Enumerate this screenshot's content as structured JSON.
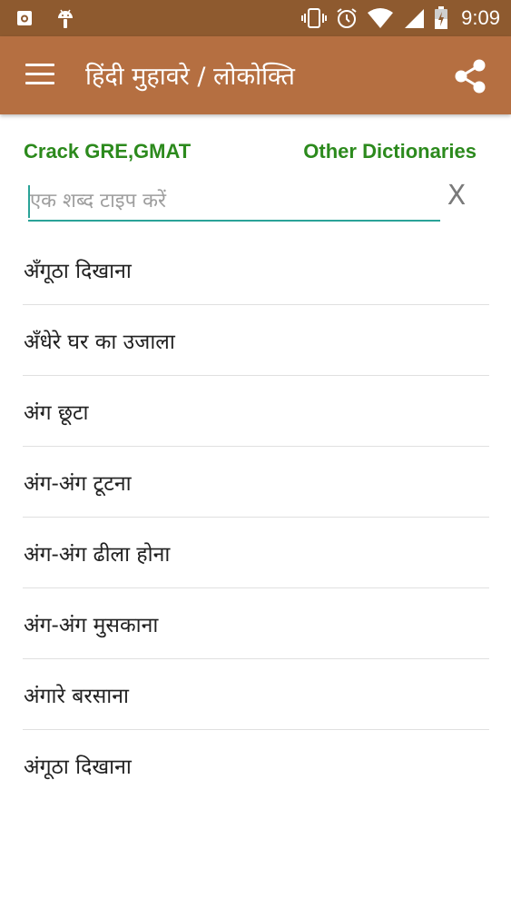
{
  "status_bar": {
    "time": "9:09",
    "icons": [
      "camera-notification-icon",
      "android-icon",
      "vibrate-icon",
      "alarm-icon",
      "wifi-icon",
      "signal-icon",
      "battery-charging-icon"
    ]
  },
  "app_bar": {
    "title": "हिंदी मुहावरे / लोकोक्ति",
    "menu_icon": "hamburger-menu-icon",
    "share_icon": "share-icon"
  },
  "links": {
    "left": "Crack GRE,GMAT",
    "right": "Other Dictionaries"
  },
  "search": {
    "value": "",
    "placeholder": "एक शब्द टाइप करें",
    "clear_label": "X"
  },
  "phrases": [
    "अँगूठा दिखाना",
    "अँधेरे घर का उजाला",
    "अंग छूटा",
    "अंग-अंग टूटना",
    "अंग-अंग ढीला होना",
    "अंग-अंग मुसकाना",
    "अंगारे बरसाना",
    "अंगूठा दिखाना"
  ],
  "colors": {
    "status_bar": "#8e5a2f",
    "app_bar": "#b56f41",
    "link": "#2c8a1d",
    "accent": "#2aa398"
  }
}
